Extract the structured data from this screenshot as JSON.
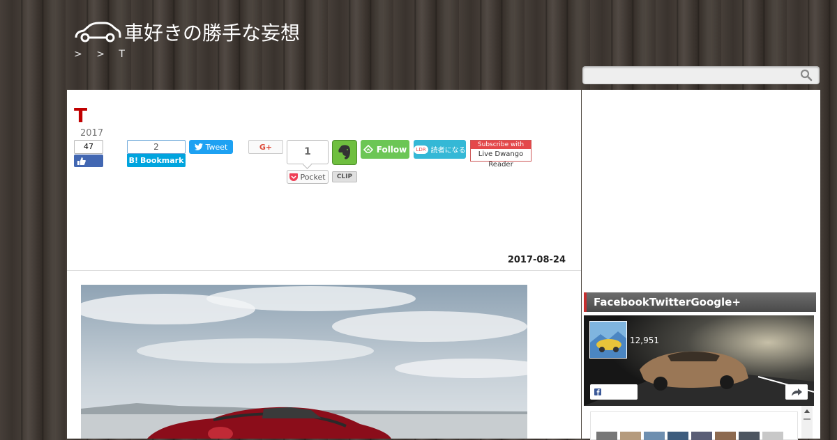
{
  "site": {
    "title": "車好きの勝手な妄想",
    "breadcrumb": [
      ">",
      ">",
      "T"
    ]
  },
  "search": {
    "placeholder": ""
  },
  "post": {
    "title": "T",
    "year": "2017",
    "date": "2017-08-24"
  },
  "share": {
    "facebook_count": "47",
    "hatena_count": "2",
    "hatena_label": "Bookmark",
    "tweet_label": "Tweet",
    "gplus_label": "G+",
    "pocket_count": "1",
    "pocket_label": "Pocket",
    "clip_label": "CLIP",
    "feedly_label": "Follow",
    "ldr_label": "読者になる",
    "ldr_badge": "LDR",
    "dwango_top": "Subscribe with",
    "dwango_bottom": "Live Dwango Reader"
  },
  "sidebar": {
    "heading": "FacebookTwitterGoogle+",
    "fb_likes": "12,951"
  },
  "colors": {
    "title_red": "#c00000",
    "facebook_blue": "#4267b2",
    "twitter_blue": "#1da1f2",
    "hatena_blue": "#00a4de",
    "feedly_green": "#6cc655",
    "evernote_green": "#6fbf3f",
    "ldr_cyan": "#34b8d6",
    "accent_red": "#c62f2f"
  }
}
